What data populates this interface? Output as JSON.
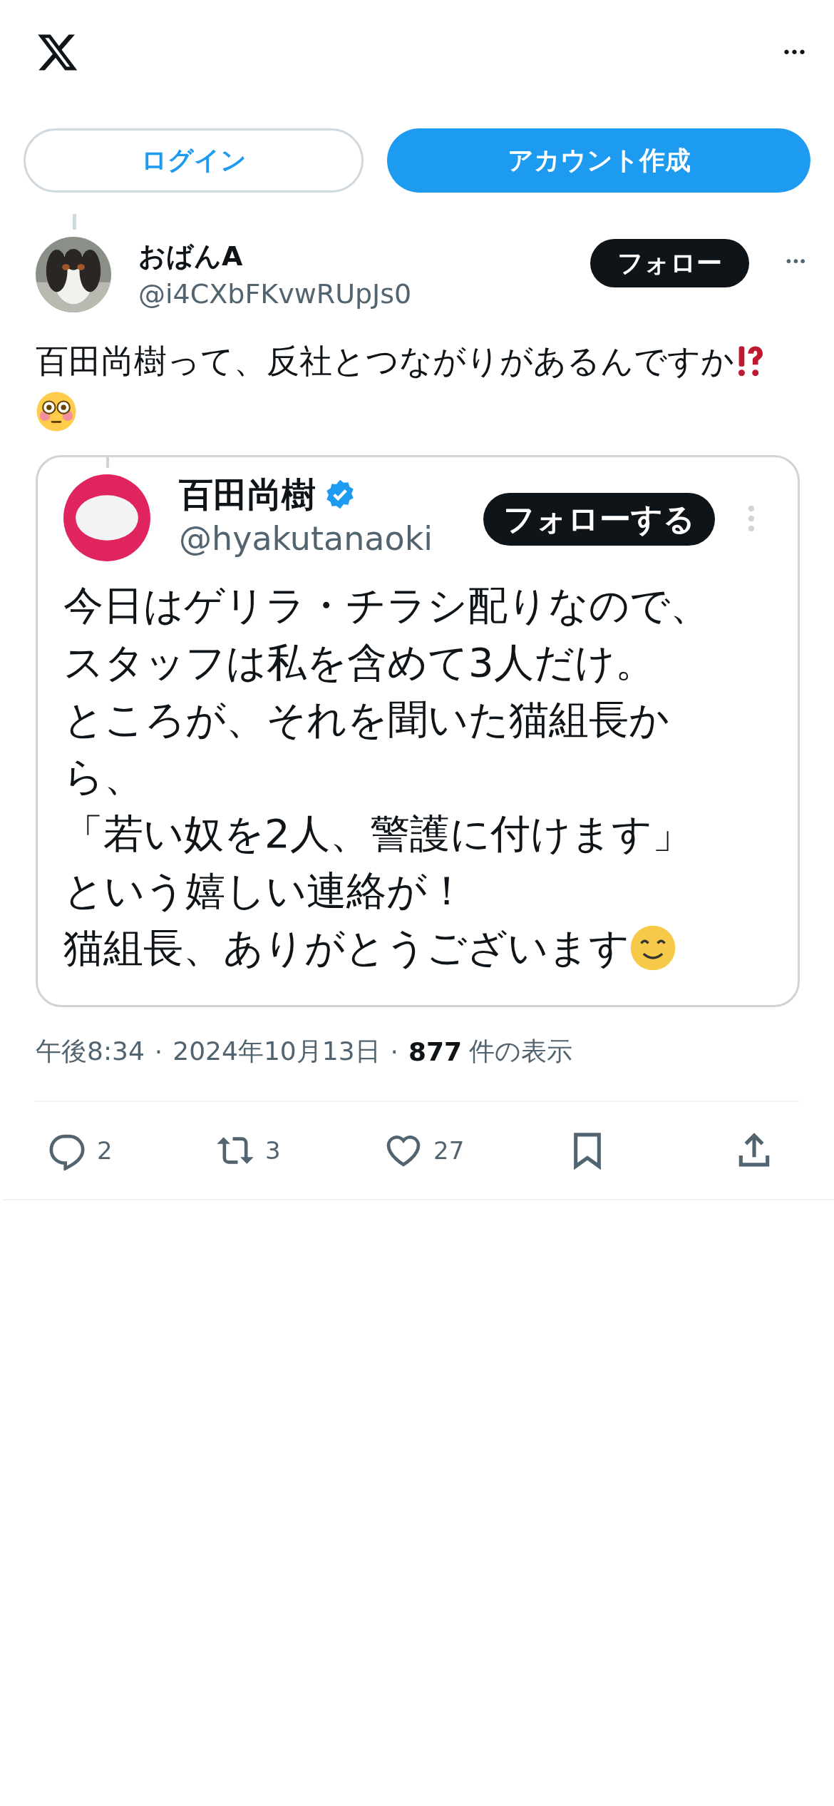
{
  "header": {
    "menu": "•••"
  },
  "auth_buttons": [
    {
      "label": "ログイン",
      "kind": "outline"
    },
    {
      "label": "アカウント作成",
      "kind": "filled"
    }
  ],
  "post": {
    "author": {
      "name": "おばんA",
      "handle": "@i4CXbFKvwRUpJs0",
      "follow": "フォロー",
      "more": "•••"
    },
    "text": "百田尚樹って、反社とつながりがあるんですか",
    "quoted_screenshot": {
      "name": "百田尚樹",
      "verified": true,
      "handle": "@hyakutanaoki",
      "follow": "フォローする",
      "lines": [
        "今日はゲリラ・チラシ配りなので、",
        "スタッフは私を含めて3人だけ。",
        "ところが、それを聞いた猫組長か",
        "ら、",
        "「若い奴を2人、警護に付けます」",
        "という嬉しい連絡が！",
        "猫組長、ありがとうございます"
      ]
    },
    "meta": {
      "time": "午後8:34",
      "separator_1": "·",
      "date": "2024年10月13日",
      "separator_2": "·",
      "views": "877",
      "views_label": "件の表示"
    },
    "actions": [
      {
        "kind": "reply",
        "count": "2"
      },
      {
        "kind": "repost",
        "count": "3"
      },
      {
        "kind": "like",
        "count": "27"
      },
      {
        "kind": "bookmark"
      },
      {
        "kind": "share"
      }
    ]
  }
}
